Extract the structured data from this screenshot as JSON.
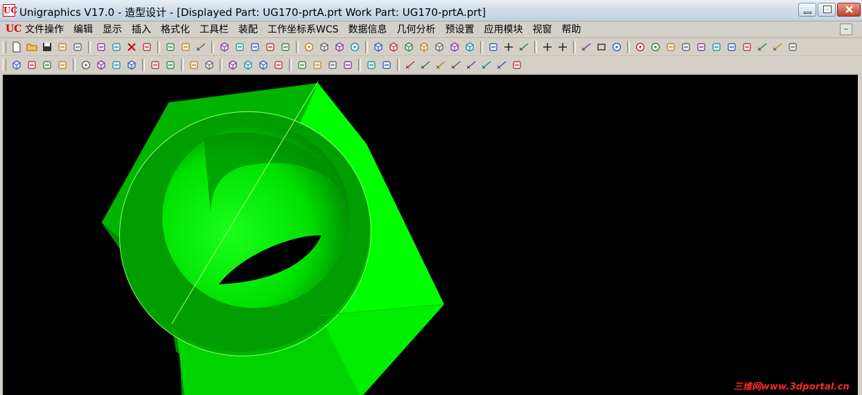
{
  "window": {
    "title": "Unigraphics V17.0 - 造型设计 - [Displayed Part: UG170-prtA.prt    Work Part: UG170-prtA.prt]",
    "logo_text": "UC"
  },
  "menubar": {
    "logo_text": "UC",
    "items": [
      "文件操作",
      "编辑",
      "显示",
      "插入",
      "格式化",
      "工具栏",
      "装配",
      "工作坐标系WCS",
      "数据信息",
      "几何分析",
      "预设置",
      "应用模块",
      "视窗",
      "帮助"
    ]
  },
  "toolbar1": {
    "icons": [
      "new-file-icon",
      "open-folder-icon",
      "save-icon",
      "print-icon",
      "undo-icon",
      "cut-icon",
      "copy-icon",
      "delete-icon",
      "edit-icon",
      "info-icon",
      "tree-icon",
      "hierarchy-icon",
      "fit-view-icon",
      "zoom-icon",
      "zoom-box-icon",
      "rotate-icon",
      "pan-icon",
      "shaded-sphere-icon",
      "shaded-cube-icon",
      "wireframe-cube-icon",
      "globe-icon",
      "view-front-icon",
      "view-top-icon",
      "view-right-icon",
      "view-iso-icon",
      "view-trimetric-icon",
      "view-left-icon",
      "view-back-icon",
      "sketch-icon",
      "point-icon",
      "spline-icon",
      "plus-icon",
      "point-set-icon",
      "arc-icon",
      "rectangle-icon",
      "circle-icon",
      "circle-center-icon",
      "sphere-feature-icon",
      "blend-icon",
      "pattern-icon",
      "mirror-icon",
      "trim-icon",
      "extend-icon",
      "offset-icon",
      "line-icon",
      "curve-icon",
      "sketch-plane-icon"
    ]
  },
  "toolbar2": {
    "icons": [
      "block-icon",
      "cylinder-icon",
      "cone-icon",
      "tube-icon",
      "hole-icon",
      "boss-icon",
      "pocket-icon",
      "pad-icon",
      "slot-icon",
      "groove-icon",
      "chamfer-icon",
      "shell-icon",
      "unite-icon",
      "subtract-icon",
      "intersect-icon",
      "sew-icon",
      "draft-icon",
      "taper-icon",
      "split-icon",
      "trim-body-icon",
      "instance-icon",
      "mirror-body-icon",
      "dimension-horizontal-icon",
      "dimension-vertical-icon",
      "dimension-parallel-icon",
      "dimension-perpendicular-icon",
      "dimension-angle-icon",
      "dimension-radius-icon",
      "dimension-diameter-icon",
      "constraint-icon"
    ]
  },
  "viewport": {
    "background": "#000000",
    "model_color": "#00e000",
    "watermark": "三维网www.3dportal.cn"
  },
  "colors": {
    "face_bright": "#00ff00",
    "face_mid": "#00c800",
    "face_dark": "#008a00",
    "edge": "#9dff7a"
  }
}
